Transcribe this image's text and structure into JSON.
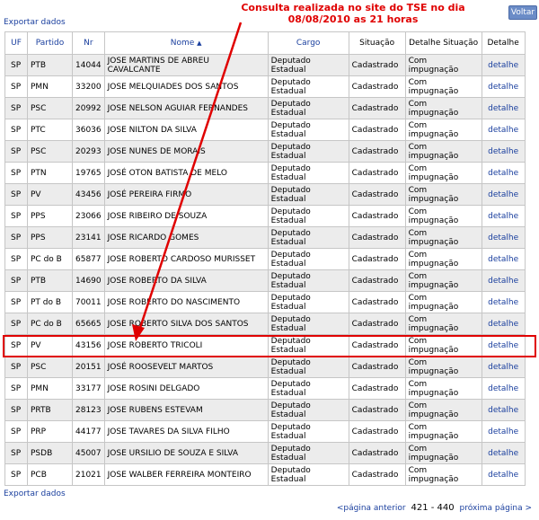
{
  "export_top_label": "Exportar dados",
  "export_bottom_label": "Exportar dados",
  "voltar_label": "Voltar",
  "annotation": {
    "line1": "Consulta realizada no site do TSE no dia",
    "line2": "08/08/2010 as 21 horas"
  },
  "colors": {
    "link": "#1a3f9e",
    "annotation": "#e00000",
    "row_alt": "#ececec",
    "button": "#6b8cc7"
  },
  "header": {
    "uf": "UF",
    "partido": "Partido",
    "nr": "Nr",
    "nome": "Nome",
    "nome_sort_icon": "▲",
    "cargo": "Cargo",
    "situacao": "Situação",
    "detalhe_situacao": "Detalhe Situação",
    "detalhe": "Detalhe"
  },
  "rows": [
    {
      "uf": "SP",
      "partido": "PTB",
      "nr": "14044",
      "nome": "JOSE MARTINS DE ABREU CAVALCANTE",
      "cargo": "Deputado Estadual",
      "situacao": "Cadastrado",
      "detalhe_situacao": "Com impugnação",
      "detalhe": "detalhe"
    },
    {
      "uf": "SP",
      "partido": "PMN",
      "nr": "33200",
      "nome": "JOSE MELQUIADES DOS SANTOS",
      "cargo": "Deputado Estadual",
      "situacao": "Cadastrado",
      "detalhe_situacao": "Com impugnação",
      "detalhe": "detalhe"
    },
    {
      "uf": "SP",
      "partido": "PSC",
      "nr": "20992",
      "nome": "JOSE NELSON AGUIAR FERNANDES",
      "cargo": "Deputado Estadual",
      "situacao": "Cadastrado",
      "detalhe_situacao": "Com impugnação",
      "detalhe": "detalhe"
    },
    {
      "uf": "SP",
      "partido": "PTC",
      "nr": "36036",
      "nome": "JOSE NILTON DA SILVA",
      "cargo": "Deputado Estadual",
      "situacao": "Cadastrado",
      "detalhe_situacao": "Com impugnação",
      "detalhe": "detalhe"
    },
    {
      "uf": "SP",
      "partido": "PSC",
      "nr": "20293",
      "nome": "JOSE NUNES DE MORAIS",
      "cargo": "Deputado Estadual",
      "situacao": "Cadastrado",
      "detalhe_situacao": "Com impugnação",
      "detalhe": "detalhe"
    },
    {
      "uf": "SP",
      "partido": "PTN",
      "nr": "19765",
      "nome": "JOSÉ OTON BATISTA DE MELO",
      "cargo": "Deputado Estadual",
      "situacao": "Cadastrado",
      "detalhe_situacao": "Com impugnação",
      "detalhe": "detalhe"
    },
    {
      "uf": "SP",
      "partido": "PV",
      "nr": "43456",
      "nome": "JOSÉ PEREIRA FIRMO",
      "cargo": "Deputado Estadual",
      "situacao": "Cadastrado",
      "detalhe_situacao": "Com impugnação",
      "detalhe": "detalhe"
    },
    {
      "uf": "SP",
      "partido": "PPS",
      "nr": "23066",
      "nome": "JOSE RIBEIRO DE SOUZA",
      "cargo": "Deputado Estadual",
      "situacao": "Cadastrado",
      "detalhe_situacao": "Com impugnação",
      "detalhe": "detalhe"
    },
    {
      "uf": "SP",
      "partido": "PPS",
      "nr": "23141",
      "nome": "JOSE RICARDO GOMES",
      "cargo": "Deputado Estadual",
      "situacao": "Cadastrado",
      "detalhe_situacao": "Com impugnação",
      "detalhe": "detalhe"
    },
    {
      "uf": "SP",
      "partido": "PC do B",
      "nr": "65877",
      "nome": "JOSE ROBERTO CARDOSO MURISSET",
      "cargo": "Deputado Estadual",
      "situacao": "Cadastrado",
      "detalhe_situacao": "Com impugnação",
      "detalhe": "detalhe"
    },
    {
      "uf": "SP",
      "partido": "PTB",
      "nr": "14690",
      "nome": "JOSE ROBERTO DA SILVA",
      "cargo": "Deputado Estadual",
      "situacao": "Cadastrado",
      "detalhe_situacao": "Com impugnação",
      "detalhe": "detalhe"
    },
    {
      "uf": "SP",
      "partido": "PT do B",
      "nr": "70011",
      "nome": "JOSE ROBERTO DO NASCIMENTO",
      "cargo": "Deputado Estadual",
      "situacao": "Cadastrado",
      "detalhe_situacao": "Com impugnação",
      "detalhe": "detalhe"
    },
    {
      "uf": "SP",
      "partido": "PC do B",
      "nr": "65665",
      "nome": "JOSE ROBERTO SILVA DOS SANTOS",
      "cargo": "Deputado Estadual",
      "situacao": "Cadastrado",
      "detalhe_situacao": "Com impugnação",
      "detalhe": "detalhe"
    },
    {
      "uf": "SP",
      "partido": "PV",
      "nr": "43156",
      "nome": "JOSE ROBERTO TRICOLI",
      "cargo": "Deputado Estadual",
      "situacao": "Cadastrado",
      "detalhe_situacao": "Com impugnação",
      "detalhe": "detalhe"
    },
    {
      "uf": "SP",
      "partido": "PSC",
      "nr": "20151",
      "nome": "JOSÉ ROOSEVELT MARTOS",
      "cargo": "Deputado Estadual",
      "situacao": "Cadastrado",
      "detalhe_situacao": "Com impugnação",
      "detalhe": "detalhe"
    },
    {
      "uf": "SP",
      "partido": "PMN",
      "nr": "33177",
      "nome": "JOSE ROSINI DELGADO",
      "cargo": "Deputado Estadual",
      "situacao": "Cadastrado",
      "detalhe_situacao": "Com impugnação",
      "detalhe": "detalhe"
    },
    {
      "uf": "SP",
      "partido": "PRTB",
      "nr": "28123",
      "nome": "JOSE RUBENS ESTEVAM",
      "cargo": "Deputado Estadual",
      "situacao": "Cadastrado",
      "detalhe_situacao": "Com impugnação",
      "detalhe": "detalhe"
    },
    {
      "uf": "SP",
      "partido": "PRP",
      "nr": "44177",
      "nome": "JOSE TAVARES DA SILVA FILHO",
      "cargo": "Deputado Estadual",
      "situacao": "Cadastrado",
      "detalhe_situacao": "Com impugnação",
      "detalhe": "detalhe"
    },
    {
      "uf": "SP",
      "partido": "PSDB",
      "nr": "45007",
      "nome": "JOSE URSILIO DE SOUZA E SILVA",
      "cargo": "Deputado Estadual",
      "situacao": "Cadastrado",
      "detalhe_situacao": "Com impugnação",
      "detalhe": "detalhe"
    },
    {
      "uf": "SP",
      "partido": "PCB",
      "nr": "21021",
      "nome": "JOSE WALBER FERREIRA MONTEIRO",
      "cargo": "Deputado Estadual",
      "situacao": "Cadastrado",
      "detalhe_situacao": "Com impugnação",
      "detalhe": "detalhe"
    }
  ],
  "pager": {
    "prev": "<página anterior",
    "range": "421 - 440",
    "next": "próxima página >"
  }
}
